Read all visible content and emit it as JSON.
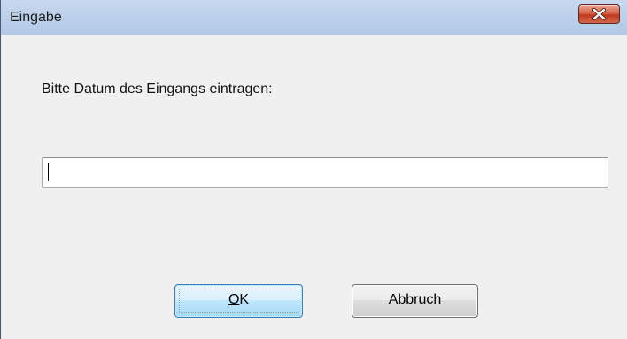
{
  "window": {
    "title": "Eingabe",
    "close_icon": "close-icon"
  },
  "dialog": {
    "prompt": "Bitte Datum des Eingangs eintragen:",
    "input_value": "",
    "ok_accel": "O",
    "ok_rest": "K",
    "cancel_label": "Abbruch"
  },
  "colors": {
    "titlebar": "#bdd1ea",
    "close_button": "#c7432a",
    "dialog_background": "#f0f0f0",
    "ok_button_focus": "#3c7fb1"
  }
}
